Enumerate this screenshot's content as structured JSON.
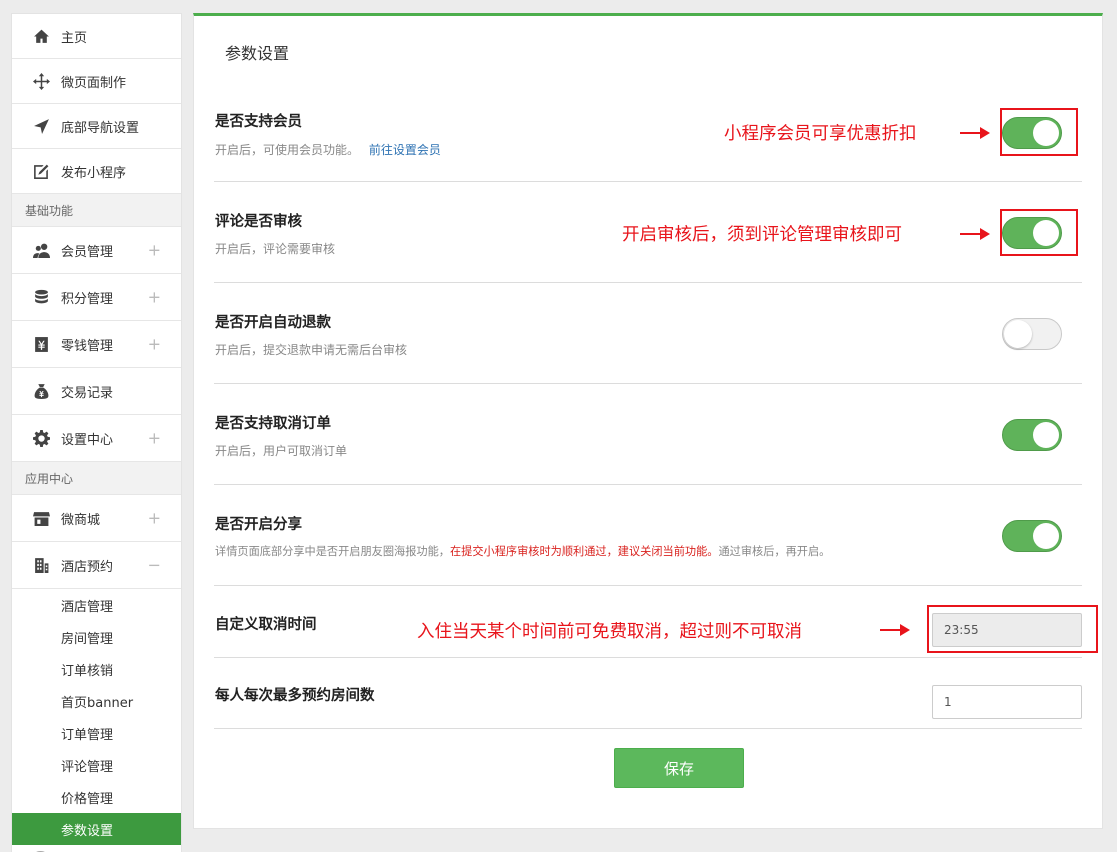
{
  "sidebar": {
    "top_items": [
      {
        "label": "主页",
        "icon": "home-icon"
      },
      {
        "label": "微页面制作",
        "icon": "move-icon"
      },
      {
        "label": "底部导航设置",
        "icon": "navigation-arrow-icon"
      },
      {
        "label": "发布小程序",
        "icon": "edit-icon"
      }
    ],
    "section_basic": "基础功能",
    "basic_items": [
      {
        "label": "会员管理",
        "icon": "users-icon",
        "expander": "+"
      },
      {
        "label": "积分管理",
        "icon": "database-icon",
        "expander": "+"
      },
      {
        "label": "零钱管理",
        "icon": "wallet-icon",
        "expander": "+"
      },
      {
        "label": "交易记录",
        "icon": "money-bag-icon"
      },
      {
        "label": "设置中心",
        "icon": "gear-icon",
        "expander": "+"
      }
    ],
    "section_apps": "应用中心",
    "app_items": [
      {
        "label": "微商城",
        "icon": "store-icon",
        "expander": "+"
      },
      {
        "label": "酒店预约",
        "icon": "building-icon",
        "expander": "−"
      }
    ],
    "sub_items": [
      {
        "label": "酒店管理"
      },
      {
        "label": "房间管理"
      },
      {
        "label": "订单核销"
      },
      {
        "label": "首页banner"
      },
      {
        "label": "订单管理"
      },
      {
        "label": "评论管理"
      },
      {
        "label": "价格管理"
      },
      {
        "label": "参数设置",
        "active": true
      }
    ]
  },
  "main": {
    "title": "参数设置",
    "settings": [
      {
        "title": "是否支持会员",
        "desc": "开启后，可使用会员功能。",
        "link": "前往设置会员",
        "enabled": true
      },
      {
        "title": "评论是否审核",
        "desc": "开启后，评论需要审核",
        "enabled": true
      },
      {
        "title": "是否开启自动退款",
        "desc": "开启后，提交退款申请无需后台审核",
        "enabled": false
      },
      {
        "title": "是否支持取消订单",
        "desc": "开启后，用户可取消订单",
        "enabled": true
      },
      {
        "title": "是否开启分享",
        "desc_prefix": "详情页面底部分享中是否开启朋友圈海报功能，",
        "desc_warn": "在提交小程序审核时为顺利通过，建议关闭当前功能。",
        "desc_suffix": "通过审核后，再开启。",
        "enabled": true
      }
    ],
    "cancel_time": {
      "label": "自定义取消时间",
      "value": "23:55"
    },
    "max_rooms": {
      "label": "每人每次最多预约房间数",
      "value": "1"
    },
    "save_label": "保存"
  },
  "annotations": [
    "小程序会员可享优惠折扣",
    "开启审核后，须到评论管理审核即可",
    "入住当天某个时间前可免费取消，超过则不可取消"
  ],
  "colors": {
    "accent_green": "#5cb85c",
    "active_nav": "#3d9a3f",
    "annotation_red": "#e8141b",
    "link_blue": "#2f73b3"
  }
}
